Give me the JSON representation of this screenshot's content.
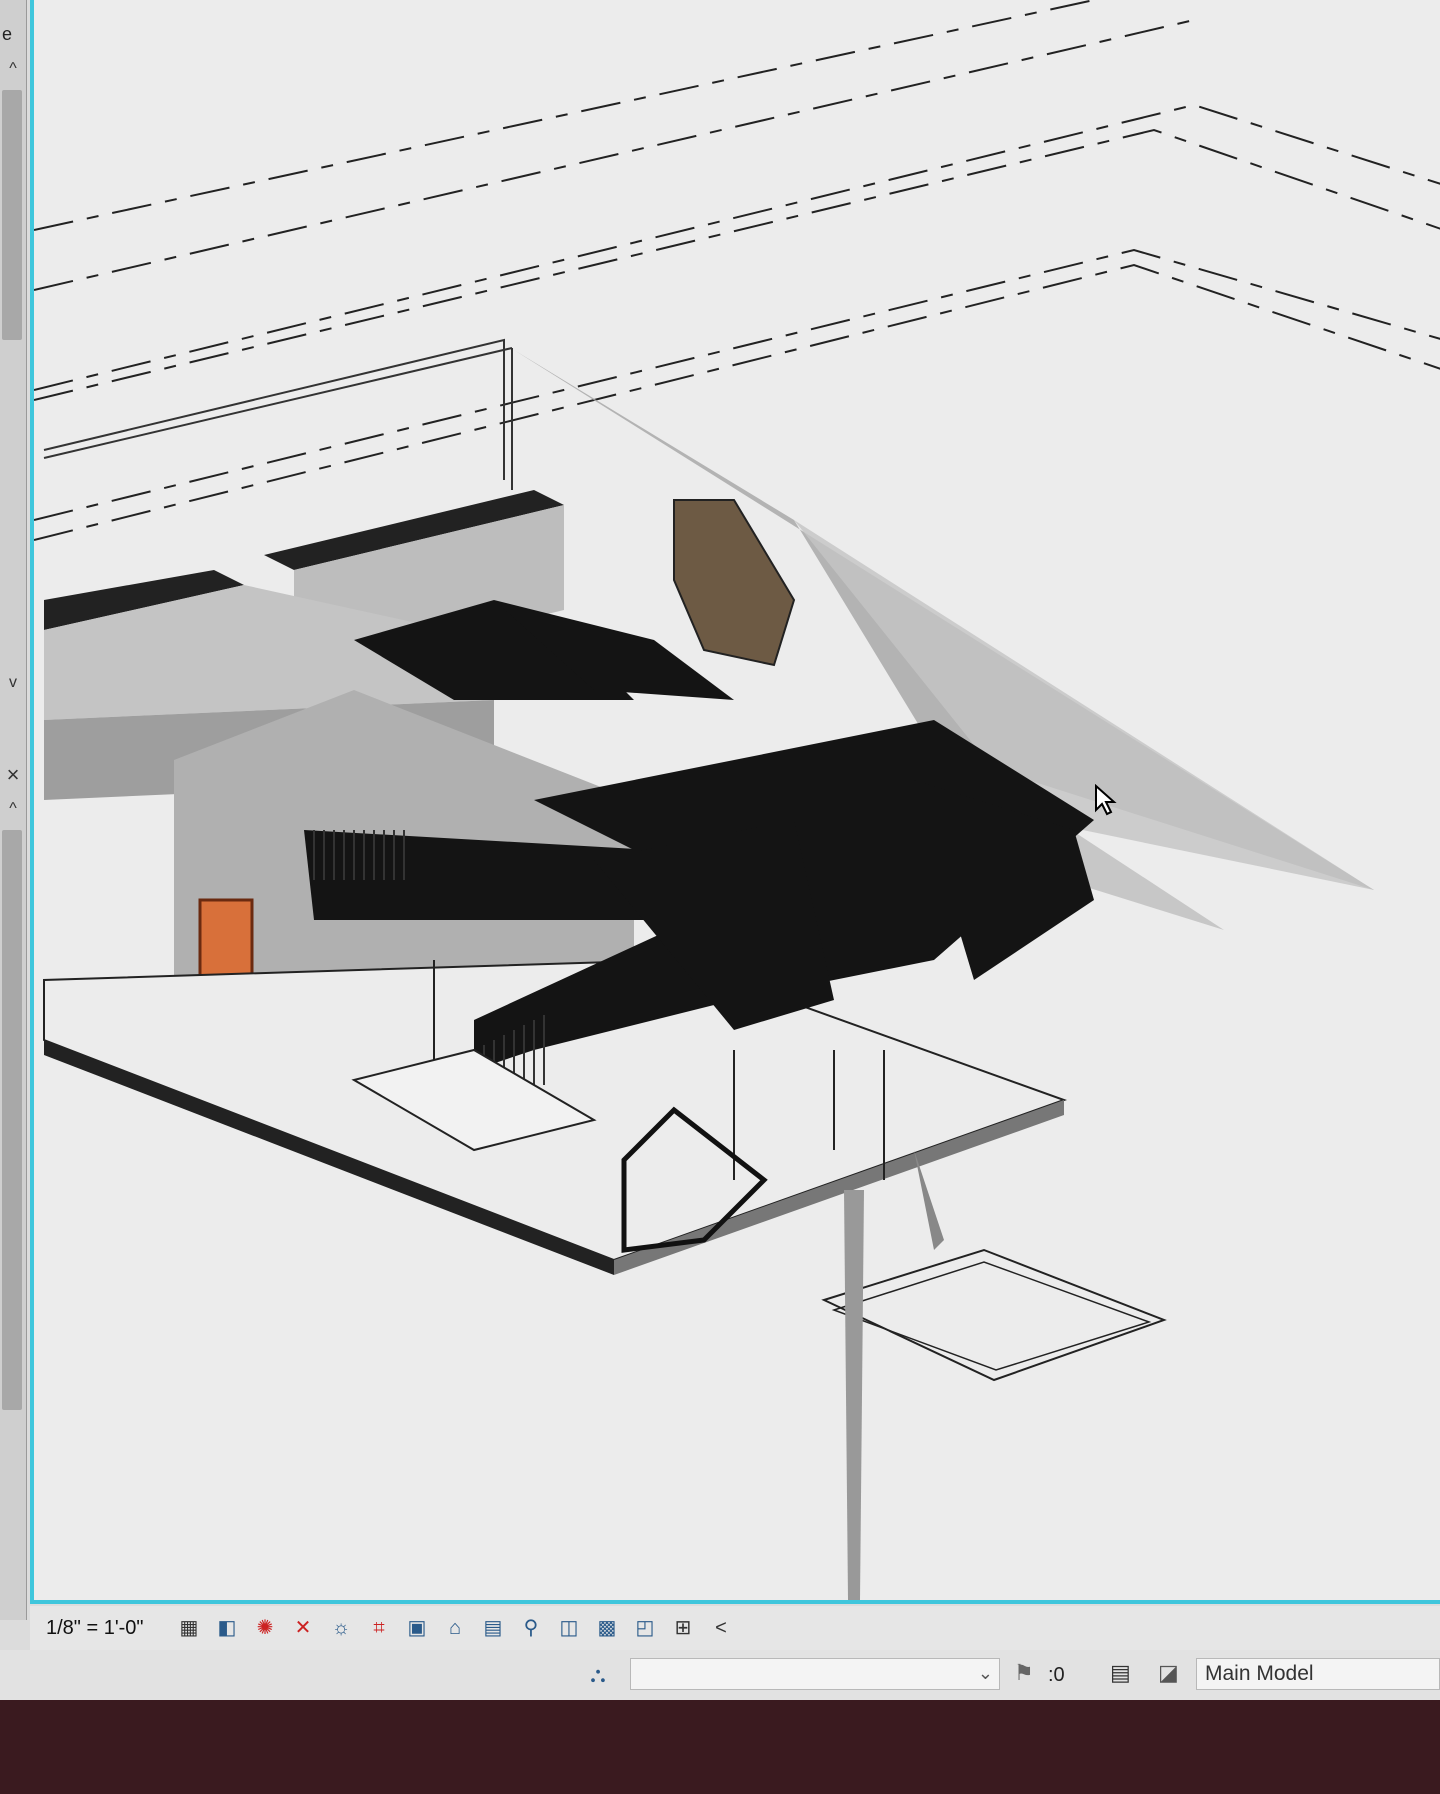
{
  "left_panel": {
    "label": "e",
    "collapse_up_1": "^",
    "collapse_down": "v",
    "close": "×",
    "collapse_up_2": "^"
  },
  "view_bar": {
    "scale": "1/8\" = 1'-0\"",
    "icons": [
      "detail-level-icon",
      "visual-style-icon",
      "sun-path-icon",
      "shadows-icon",
      "show-rendering-icon",
      "crop-view-icon",
      "show-crop-region-icon",
      "temporary-hide-icon",
      "reveal-hidden-icon",
      "temporary-view-properties-icon",
      "analytical-model-icon",
      "highlight-displacement-icon",
      "worksharing-display-icon",
      "constraints-icon",
      "expand-arrow-icon"
    ],
    "expand": "<"
  },
  "status_bar": {
    "editable_count": ":0",
    "design_option": "Main Model",
    "workset_value": ""
  },
  "colors": {
    "viewport_border": "#3fc6dc",
    "door": "#d8703a",
    "bezel": "#3a1a1f"
  }
}
